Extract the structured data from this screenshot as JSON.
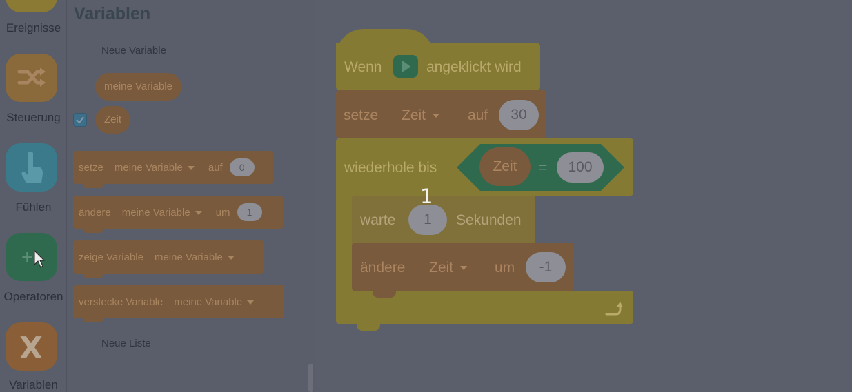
{
  "categories": [
    {
      "label": "Ereignisse",
      "color": "#8a7a33",
      "icon": "flag-icon"
    },
    {
      "label": "Steuerung",
      "color": "#8a6a3a",
      "icon": "shuffle-icon"
    },
    {
      "label": "Fühlen",
      "color": "#3a7a8a",
      "icon": "hand-pointer-icon"
    },
    {
      "label": "Operatoren",
      "color": "#2f6a4e",
      "icon": "plus-minus-icon"
    },
    {
      "label": "Variablen",
      "color": "#8a5e36",
      "icon": "x-icon"
    }
  ],
  "palette": {
    "title": "Variablen",
    "new_variable": "Neue Variable",
    "variables": [
      "meine Variable",
      "Zeit"
    ],
    "blocks": {
      "set": {
        "verb": "setze",
        "var": "meine Variable",
        "prep": "auf",
        "value": "0"
      },
      "change": {
        "verb": "ändere",
        "var": "meine Variable",
        "prep": "um",
        "value": "1"
      },
      "show": {
        "verb": "zeige Variable",
        "var": "meine Variable"
      },
      "hide": {
        "verb": "verstecke Variable",
        "var": "meine Variable"
      }
    },
    "new_list": "Neue Liste"
  },
  "script": {
    "hat": {
      "pre": "Wenn",
      "post": "angeklickt wird"
    },
    "set": {
      "verb": "setze",
      "var": "Zeit",
      "prep": "auf",
      "value": "30"
    },
    "repeat_until": {
      "label": "wiederhole bis",
      "var": "Zeit",
      "op": "=",
      "value": "100"
    },
    "wait": {
      "verb": "warte",
      "value": "1",
      "unit": "Sekunden"
    },
    "change": {
      "verb": "ändere",
      "var": "Zeit",
      "prep": "um",
      "value": "-1"
    },
    "overlay_number": "1"
  },
  "colors": {
    "events": "#847a33",
    "variables": "#7a5a3c",
    "operators": "#2f6a4e",
    "overlay": "#585b68"
  }
}
